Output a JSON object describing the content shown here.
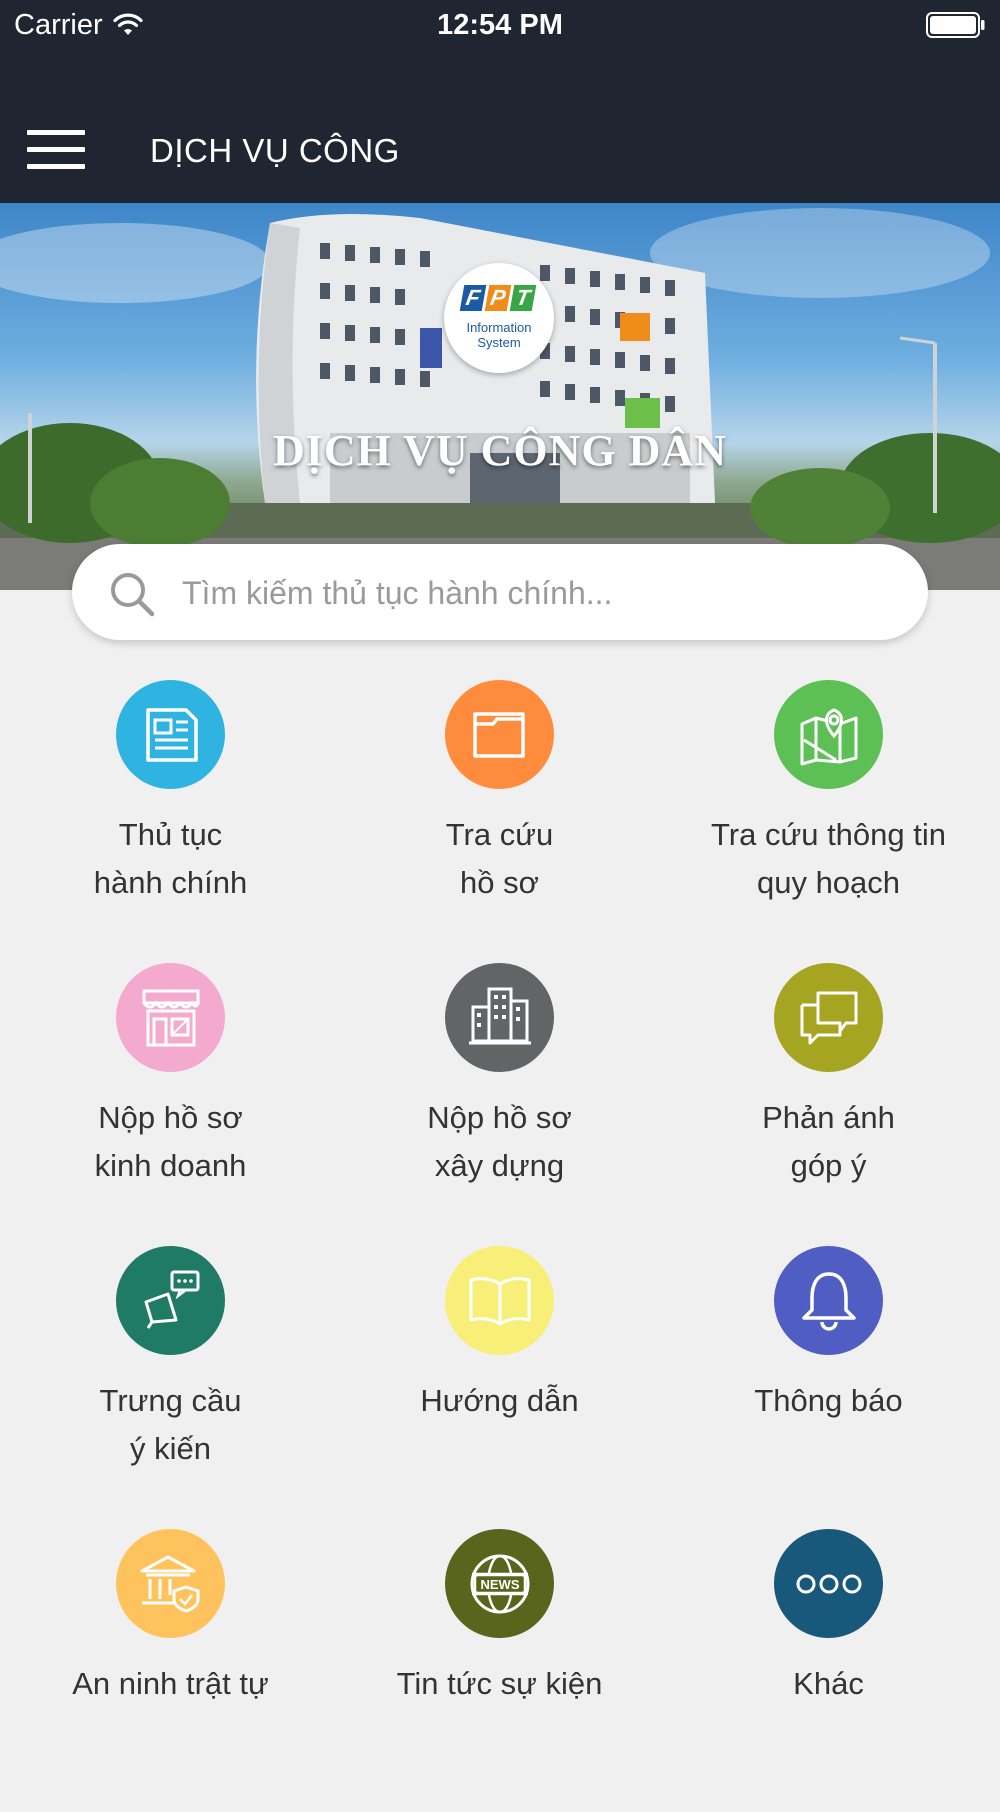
{
  "status_bar": {
    "carrier": "Carrier",
    "time": "12:54 PM"
  },
  "header": {
    "title": "DỊCH VỤ CÔNG",
    "menu_icon": "hamburger-menu-icon"
  },
  "banner": {
    "title": "DỊCH VỤ CÔNG DÂN",
    "logo": {
      "letters": [
        "F",
        "P",
        "T"
      ],
      "subtitle_line1": "Information",
      "subtitle_line2": "System"
    }
  },
  "search": {
    "placeholder": "Tìm kiếm thủ tục hành chính...",
    "value": ""
  },
  "services": [
    {
      "line1": "Thủ tục",
      "line2": "hành chính",
      "icon": "document-icon",
      "color": "#2fb3e0"
    },
    {
      "line1": "Tra cứu",
      "line2": "hồ sơ",
      "icon": "folder-icon",
      "color": "#ff8c3c"
    },
    {
      "line1": "Tra cứu thông tin",
      "line2": "quy hoạch",
      "icon": "map-pin-icon",
      "color": "#5cc055"
    },
    {
      "line1": "Nộp hồ sơ",
      "line2": "kinh doanh",
      "icon": "storefront-icon",
      "color": "#f4a9cf"
    },
    {
      "line1": "Nộp hồ sơ",
      "line2": "xây dựng",
      "icon": "buildings-icon",
      "color": "#616565"
    },
    {
      "line1": "Phản ánh",
      "line2": "góp ý",
      "icon": "chat-bubbles-icon",
      "color": "#a5a522"
    },
    {
      "line1": "Trưng cầu",
      "line2": "ý kiến",
      "icon": "megaphone-icon",
      "color": "#1f7a66"
    },
    {
      "line1": "Hướng dẫn",
      "line2": "",
      "icon": "open-book-icon",
      "color": "#f8ef78"
    },
    {
      "line1": "Thông báo",
      "line2": "",
      "icon": "bell-icon",
      "color": "#505ec4"
    },
    {
      "line1": "An ninh trật tự",
      "line2": "",
      "icon": "government-building-icon",
      "color": "#ffc35e"
    },
    {
      "line1": "Tin tức sự kiện",
      "line2": "",
      "icon": "news-globe-icon",
      "color": "#59641c"
    },
    {
      "line1": "Khác",
      "line2": "",
      "icon": "more-dots-icon",
      "color": "#17587b"
    }
  ]
}
